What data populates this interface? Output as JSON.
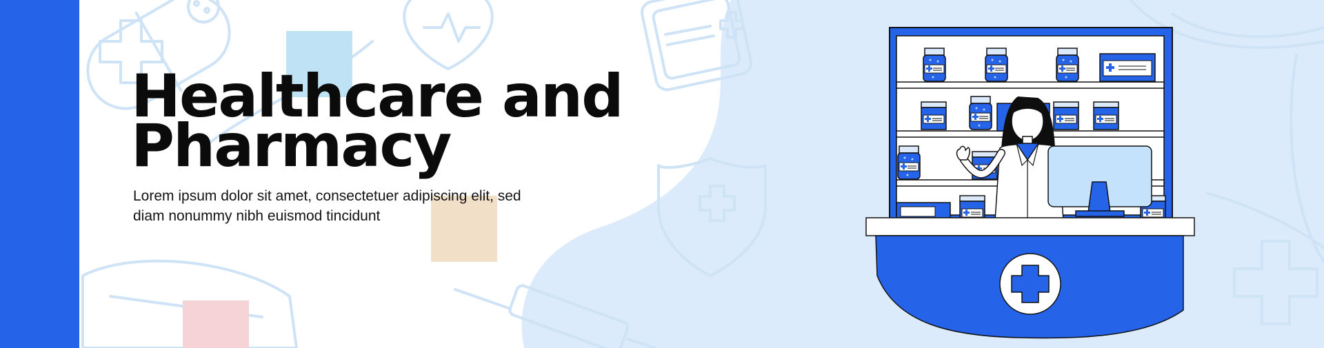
{
  "banner": {
    "title_line1": "Healthcare and",
    "title_line2": "Pharmacy",
    "body_line1": "Lorem ipsum dolor sit amet, consectetuer adipiscing elit, sed",
    "body_line2": "diam nonummy nibh euismod tincidunt"
  },
  "colors": {
    "brand_blue": "#2563e8",
    "light_blue": "#dcebfb",
    "square_blue": "#bfe3f4",
    "square_peach": "#f1e0c7",
    "square_pink": "#f6d3d6",
    "title_text": "#0b0b0b"
  },
  "icons": [
    "plus-icon",
    "heart-pulse-icon",
    "shield-cross-icon",
    "syringe-icon",
    "bandage-icon",
    "medicine-bottle-icon",
    "pill-capsule-icon",
    "virus-icon"
  ]
}
